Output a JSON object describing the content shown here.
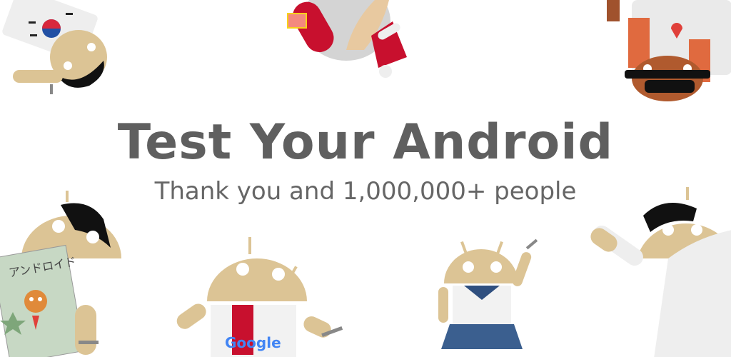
{
  "banner": {
    "title": "Test Your Android",
    "subtitle": "Thank you and 1,000,000+ people"
  },
  "decorations": {
    "magazine_text": "アンドロイド",
    "shirt_logo": "Google"
  },
  "colors": {
    "android_skin": "#dcc495",
    "title_text": "#5f5f5f",
    "subtitle_text": "#666666",
    "background": "#ffffff"
  }
}
